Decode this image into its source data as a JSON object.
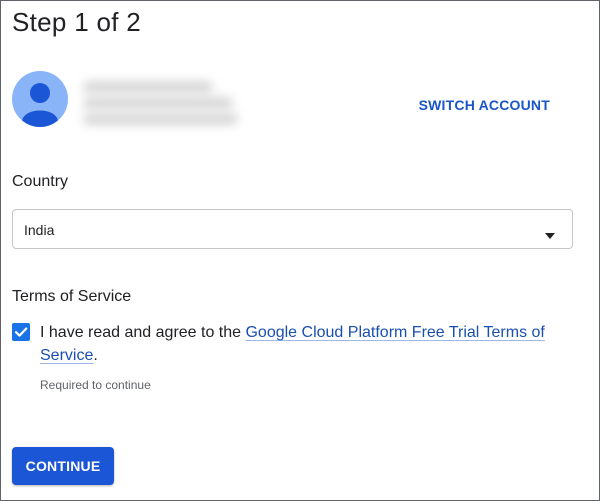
{
  "header": {
    "title": "Step 1 of 2"
  },
  "account": {
    "avatar_icon": "person-avatar-icon",
    "switch_label": "SWITCH ACCOUNT"
  },
  "country": {
    "label": "Country",
    "selected": "India",
    "dropdown_icon": "caret-down-icon"
  },
  "terms": {
    "label": "Terms of Service",
    "checked": true,
    "agreement_text": "I have read and agree to the ",
    "link_text": "Google Cloud Platform Free Trial Terms of Service",
    "trailing_text": ".",
    "helper_text": "Required to continue"
  },
  "actions": {
    "continue_label": "CONTINUE"
  },
  "colors": {
    "accent": "#1a73e8",
    "link": "#1a4fb0",
    "button": "#1a56d6",
    "avatar_bg": "#8ab4f8"
  }
}
